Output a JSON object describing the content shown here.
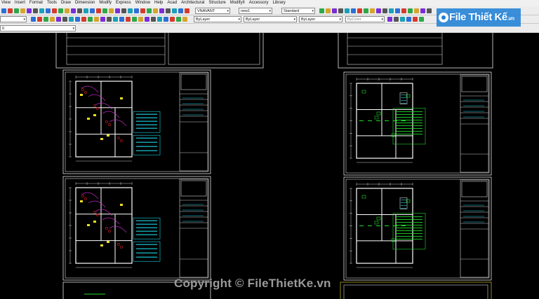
{
  "menu": [
    "View",
    "Insert",
    "Format",
    "Tools",
    "Draw",
    "Dimension",
    "Modify",
    "Express",
    "Window",
    "Help",
    "Acad",
    "Architectural",
    "Structure",
    "ModifyII",
    "Accessory",
    "Library"
  ],
  "toolbar": {
    "text_style": "VNAVANT",
    "dim_style": "new1",
    "table_style": "Standard",
    "layer": "0",
    "color": "ByLayer",
    "linetype": "ByLayer",
    "lineweight": "ByLayer",
    "plotstyle": "ByColor"
  },
  "logo": {
    "text_main": "File Thiết Kế",
    "text_tld": ".vn",
    "icon": "gear-icon"
  },
  "watermark": "Copyright © FileThietKe.vn",
  "colors": {
    "canvas": "#000000",
    "sheet_border": "#ffffff",
    "wall": "#ffffff",
    "dim": "#ffffff",
    "green_text": "#1fdc2a",
    "cyan_text": "#1ad4e6",
    "magenta": "#e02de0",
    "red": "#e22020",
    "yellow": "#f0e020",
    "logo_blue": "#1c7fd6"
  }
}
